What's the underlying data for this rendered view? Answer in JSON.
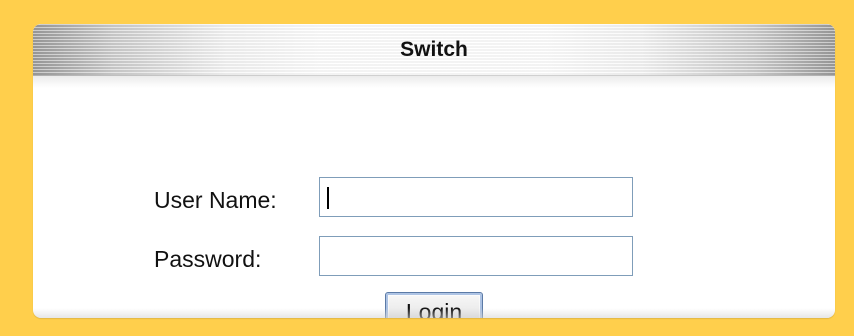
{
  "app": {
    "title": "Switch"
  },
  "form": {
    "username_label": "User Name:",
    "password_label": "Password:",
    "login_label": "Login",
    "username_value": "",
    "password_value": ""
  },
  "colors": {
    "background": "#ffcf4c",
    "panel": "#ffffff",
    "input_border": "#7f9db9",
    "button_border": "#5b7aa6"
  }
}
